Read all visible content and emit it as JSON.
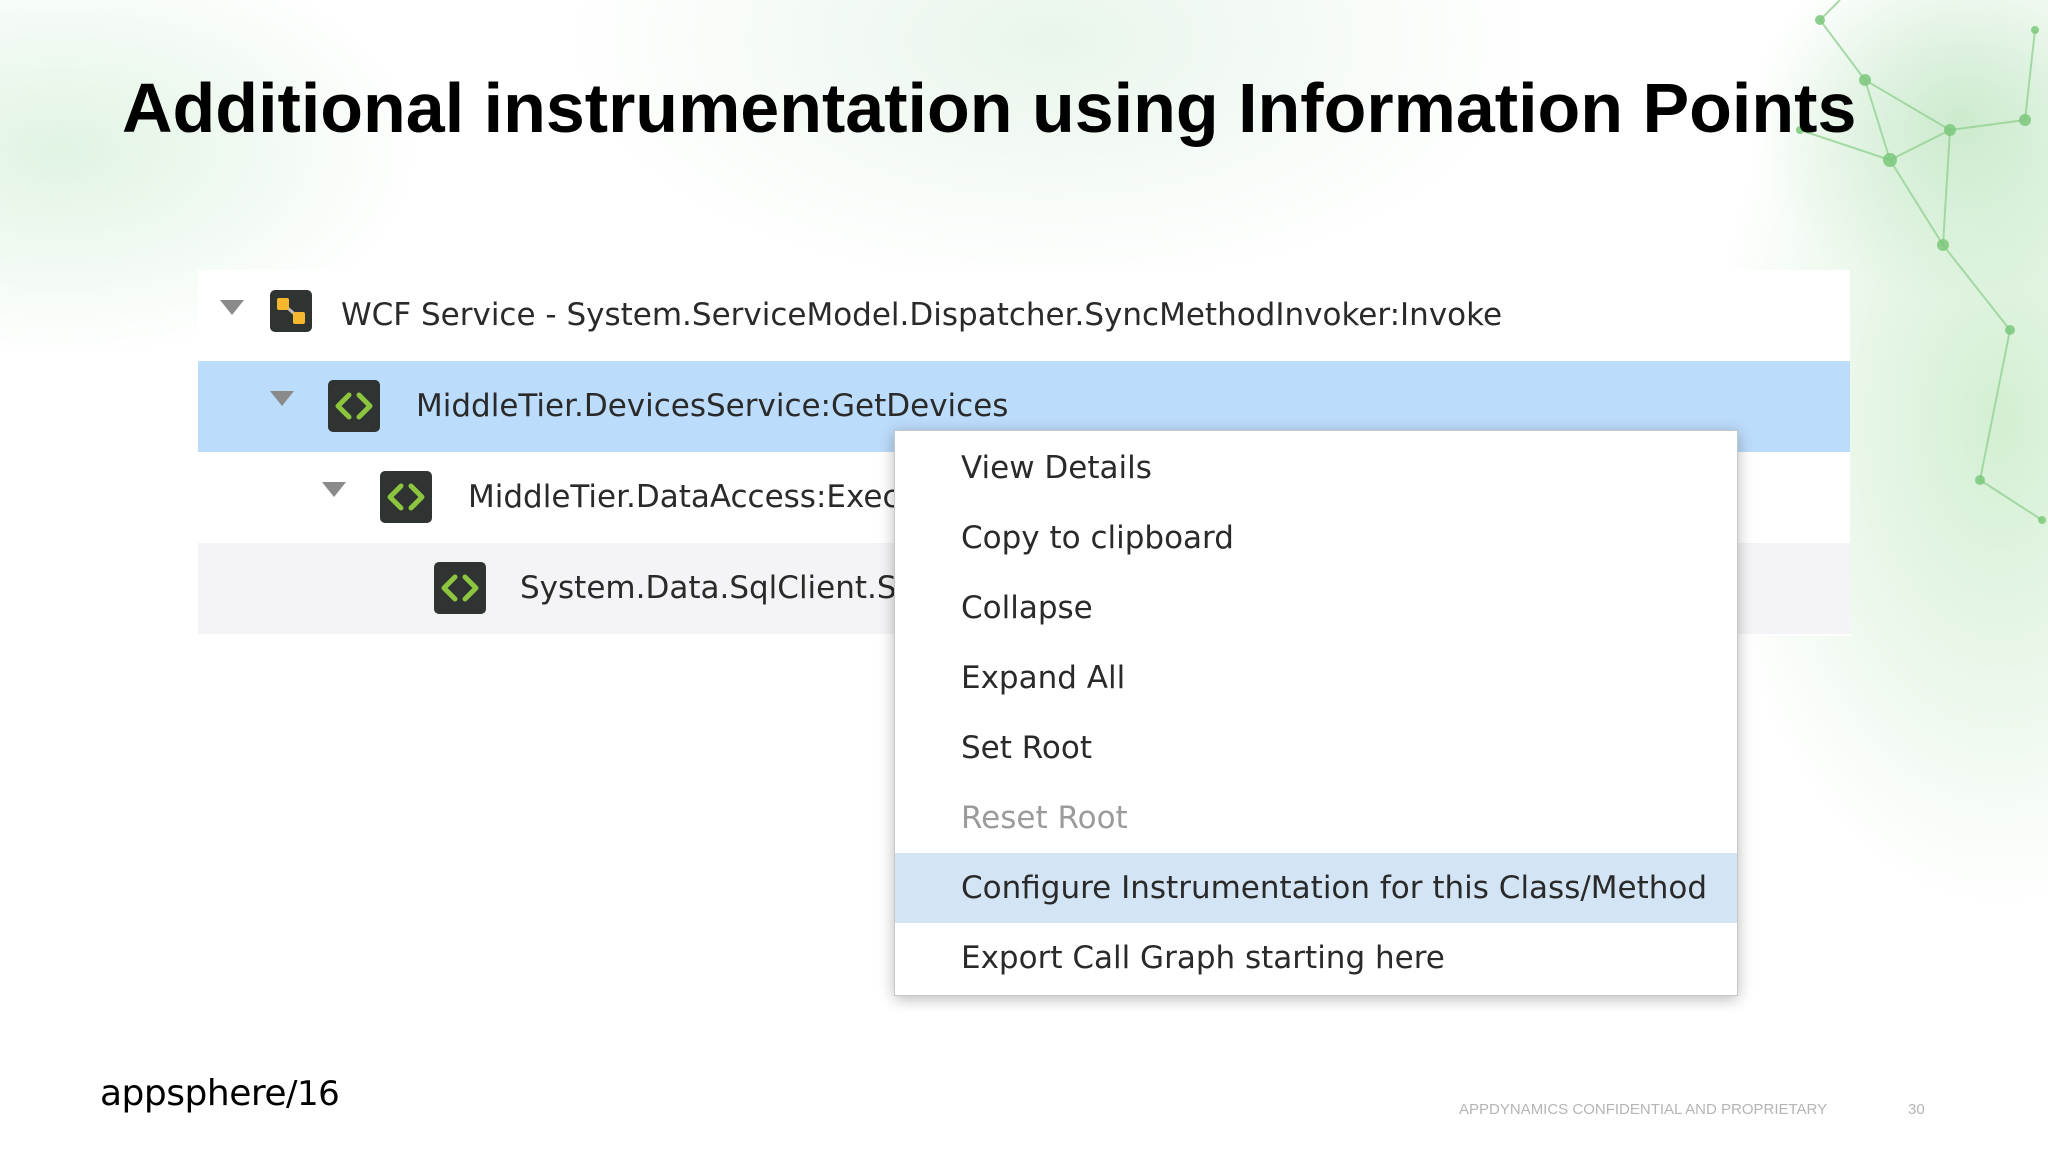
{
  "slide": {
    "title": "Additional instrumentation using Information Points",
    "brand": {
      "name": "appsphere",
      "suffix": "/16"
    },
    "footer": {
      "confidential": "APPDYNAMICS CONFIDENTIAL AND PROPRIETARY",
      "page_number": "30"
    }
  },
  "tree": {
    "rows": [
      {
        "label": "WCF Service - System.ServiceModel.Dispatcher.SyncMethodInvoker:Invoke",
        "icon": "service-icon",
        "expanded": true,
        "selected": false
      },
      {
        "label": "MiddleTier.DevicesService:GetDevices",
        "icon": "code-icon",
        "expanded": true,
        "selected": true
      },
      {
        "label": "MiddleTier.DataAccess:Execu",
        "icon": "code-icon",
        "expanded": true,
        "selected": false
      },
      {
        "label": "System.Data.SqlClient.Sql",
        "icon": "code-icon",
        "expanded": false,
        "selected": false
      }
    ]
  },
  "context_menu": {
    "items": [
      {
        "label": "View Details",
        "enabled": true,
        "highlighted": false
      },
      {
        "label": "Copy to clipboard",
        "enabled": true,
        "highlighted": false
      },
      {
        "label": "Collapse",
        "enabled": true,
        "highlighted": false
      },
      {
        "label": "Expand All",
        "enabled": true,
        "highlighted": false
      },
      {
        "label": "Set Root",
        "enabled": true,
        "highlighted": false
      },
      {
        "label": "Reset Root",
        "enabled": false,
        "highlighted": false
      },
      {
        "label": "Configure Instrumentation for this Class/Method",
        "enabled": true,
        "highlighted": true
      },
      {
        "label": "Export Call Graph starting here",
        "enabled": true,
        "highlighted": false
      }
    ]
  },
  "colors": {
    "selected_row": "#bcdcfb",
    "highlighted_menu_item": "#d3e5f4",
    "icon_background": "#2f3331",
    "code_icon_accent": "#8cc63f",
    "service_icon_accent": "#f5b72d",
    "disabled_text": "#9b9b9b"
  }
}
